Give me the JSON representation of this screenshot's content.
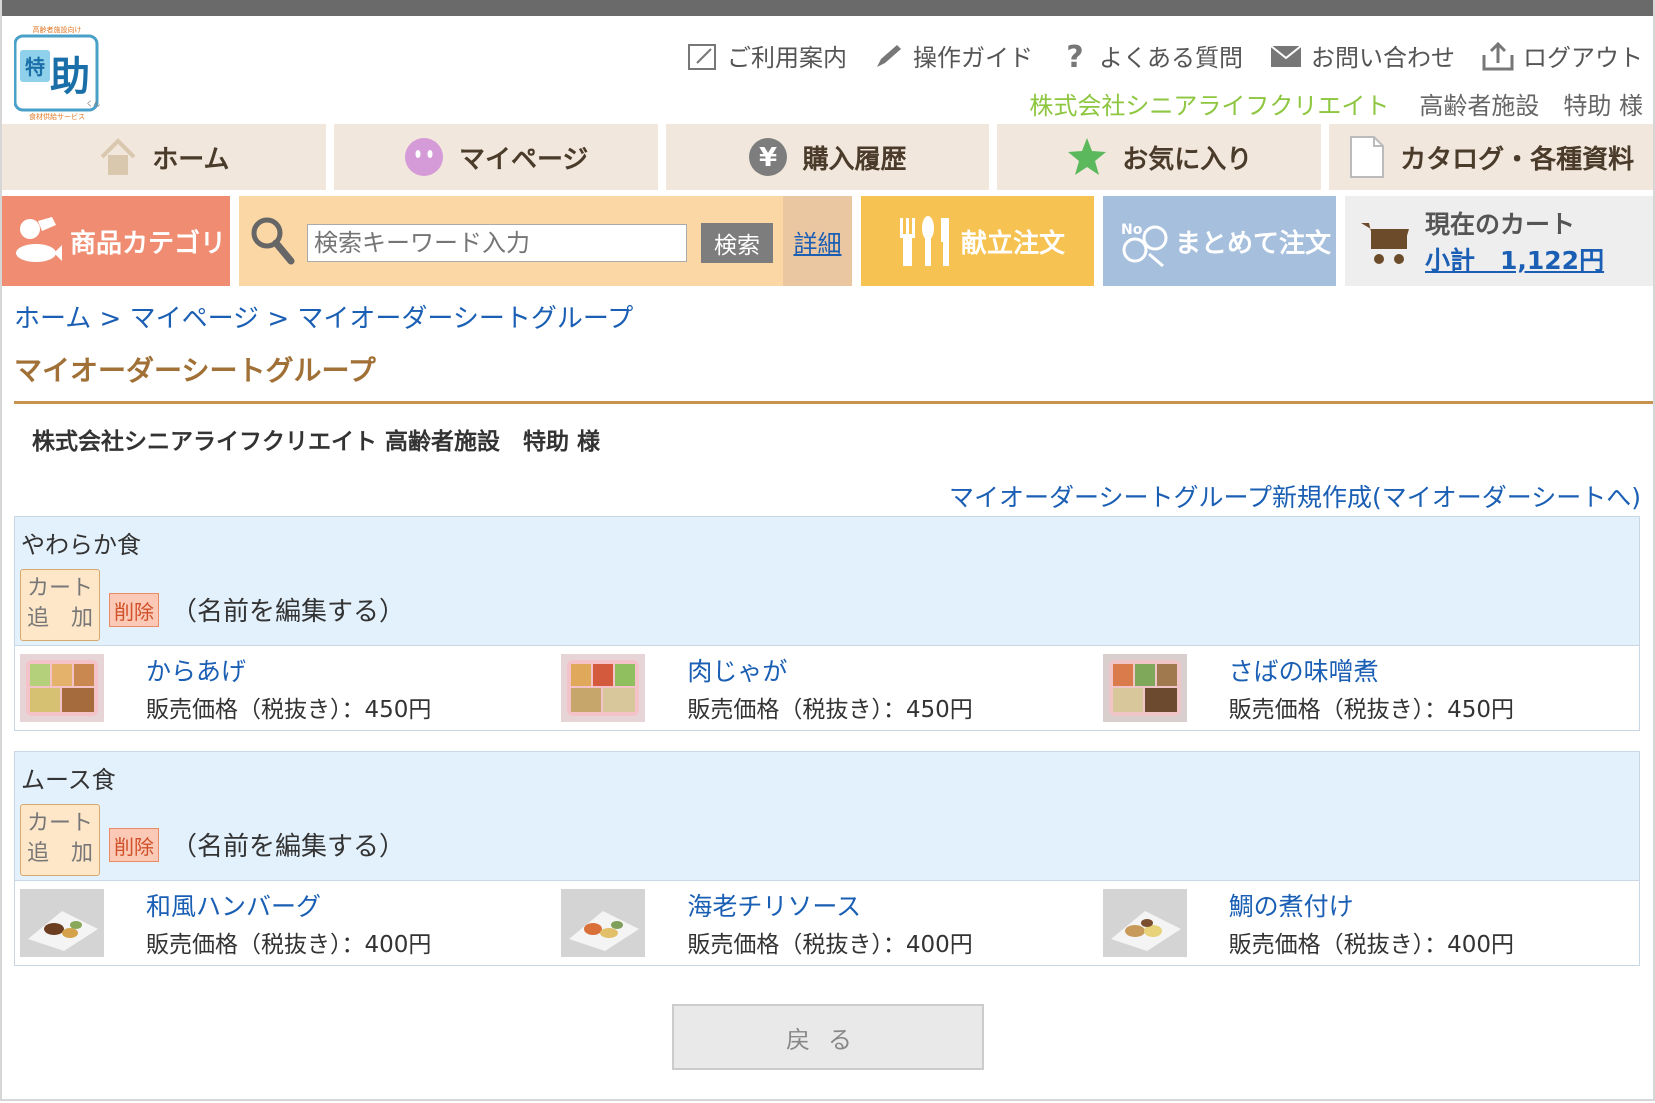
{
  "logo": {
    "tagline": "高齢者施設向け",
    "name": "特助",
    "suffix": "くん",
    "service": "食材供給サービス"
  },
  "utility_links": [
    {
      "label": "ご利用案内",
      "icon": "edit-box-icon"
    },
    {
      "label": "操作ガイド",
      "icon": "pencil-icon"
    },
    {
      "label": "よくある質問",
      "icon": "question-icon"
    },
    {
      "label": "お問い合わせ",
      "icon": "mail-icon"
    },
    {
      "label": "ログアウト",
      "icon": "logout-icon"
    }
  ],
  "user": {
    "company": "株式会社シニアライフクリエイト",
    "facility": "高齢者施設　特助 様"
  },
  "nav": [
    {
      "label": "ホーム",
      "icon": "home-icon"
    },
    {
      "label": "マイページ",
      "icon": "face-icon"
    },
    {
      "label": "購入履歴",
      "icon": "yen-icon"
    },
    {
      "label": "お気に入り",
      "icon": "star-icon"
    },
    {
      "label": "カタログ・各種資料",
      "icon": "document-icon"
    }
  ],
  "toolbar": {
    "category_label": "商品カテゴリ",
    "search_placeholder": "検索キーワード入力",
    "search_button": "検索",
    "detail_link": "詳細",
    "menu_order": "献立注文",
    "bulk_order": "まとめて注文",
    "cart_title": "現在のカート",
    "cart_subtotal": "小計　1,122円"
  },
  "breadcrumb": [
    "ホーム",
    "マイページ",
    "マイオーダーシートグループ"
  ],
  "breadcrumb_sep": ">",
  "page_title": "マイオーダーシートグループ",
  "customer_line": "株式会社シニアライフクリエイト 高齢者施設　特助 様",
  "new_group_link": "マイオーダーシートグループ新規作成(マイオーダーシートへ)",
  "cart_add_label": [
    "カート",
    "追　加"
  ],
  "delete_label": "削除",
  "edit_name_label": "（名前を編集する）",
  "groups": [
    {
      "name": "やわらか食",
      "items": [
        {
          "name": "からあげ",
          "price": "販売価格（税抜き）：450円"
        },
        {
          "name": "肉じゃが",
          "price": "販売価格（税抜き）：450円"
        },
        {
          "name": "さばの味噌煮",
          "price": "販売価格（税抜き）：450円"
        }
      ]
    },
    {
      "name": "ムース食",
      "items": [
        {
          "name": "和風ハンバーグ",
          "price": "販売価格（税抜き）：400円"
        },
        {
          "name": "海老チリソース",
          "price": "販売価格（税抜き）：400円"
        },
        {
          "name": "鯛の煮付け",
          "price": "販売価格（税抜き）：400円"
        }
      ]
    }
  ],
  "back_button": "戻る"
}
